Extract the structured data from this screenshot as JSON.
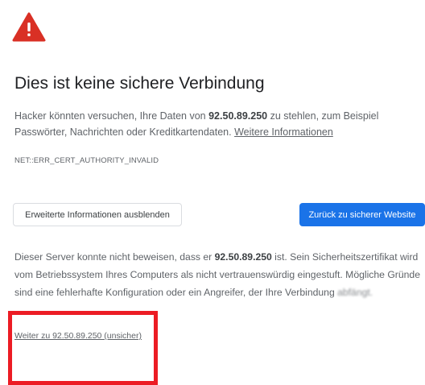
{
  "page": {
    "warning_icon": "warning-triangle-icon",
    "title": "Dies ist keine sichere Verbindung",
    "intro": {
      "before_host": "Hacker könnten versuchen, Ihre Daten von ",
      "host": "92.50.89.250",
      "after_host": " zu stehlen, zum Beispiel Passwörter, Nachrichten oder Kreditkartendaten. ",
      "link": "Weitere Informationen"
    },
    "error_code": "NET::ERR_CERT_AUTHORITY_INVALID",
    "buttons": {
      "hide_advanced": "Erweiterte Informationen ausblenden",
      "back_to_safety": "Zurück zu sicherer Website"
    },
    "details": {
      "before_host": "Dieser Server konnte nicht beweisen, dass er ",
      "host": "92.50.89.250",
      "after_host": " ist. Sein Sicherheitszertifikat wird vom Betriebssystem Ihres Computers als nicht vertrauenswürdig eingestuft. Mögliche Gründe sind eine fehlerhafte Konfiguration oder ein Angreifer, der Ihre Verbindung ",
      "trailing_blurred": "abfängt."
    },
    "proceed_link": "Weiter zu 92.50.89.250 (unsicher)"
  },
  "colors": {
    "warning_red": "#d93025",
    "primary_blue": "#1a73e8",
    "annotation_red": "#ec1c24"
  }
}
